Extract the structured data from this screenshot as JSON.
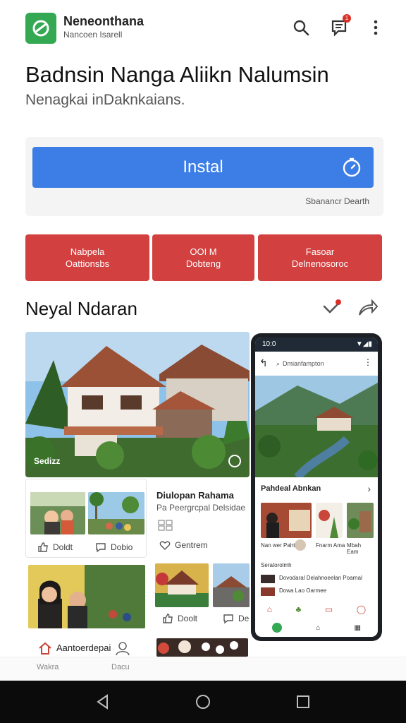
{
  "header": {
    "app_name": "Neneonthana",
    "app_sub": "Nancoen Isarell",
    "brand_color": "#34a853"
  },
  "hero_text": {
    "title": "Badnsin Nanga Aliikn Nalumsin",
    "subtitle": "Nenagkai inDaknkaians."
  },
  "install": {
    "button_label": "Instal",
    "note": "Sbanancr Dearth",
    "button_color": "#3c7ee6"
  },
  "actions": [
    {
      "line1": "Nabpela",
      "line2": "Oattionsbs"
    },
    {
      "line1": "OOI M",
      "line2": "Dobteng"
    },
    {
      "line1": "Fasoar",
      "line2": "Delnenosoroc"
    }
  ],
  "action_color": "#d24040",
  "section": {
    "title": "Neyal Ndaran"
  },
  "hero_card": {
    "label": "Sedizz"
  },
  "cards": {
    "first": {
      "action_left": "Doldt",
      "action_right": "Dobio"
    },
    "second": {
      "title": "Diulopan Rahama",
      "sub": "Pa Peergrcpal Delsidae",
      "action": "Gentrem"
    },
    "third": {
      "action": "Doolt",
      "action_right": "De"
    },
    "fourth": {
      "title": "Aantoerdepai"
    }
  },
  "phone": {
    "time": "10:0",
    "search": "Dmianfampton",
    "section": "Pahdeal Abnkan",
    "captions": [
      "Nan wer Pahtas",
      "Fnarm Ama",
      "Mbah Eam"
    ],
    "row1": "Seratorolmh",
    "row2": "Dovodaral Delahnoeelan Poarnal",
    "row3": "Dowa Lao Oarmee"
  },
  "bottom_tabs": [
    "Wakra",
    "Dacu"
  ]
}
